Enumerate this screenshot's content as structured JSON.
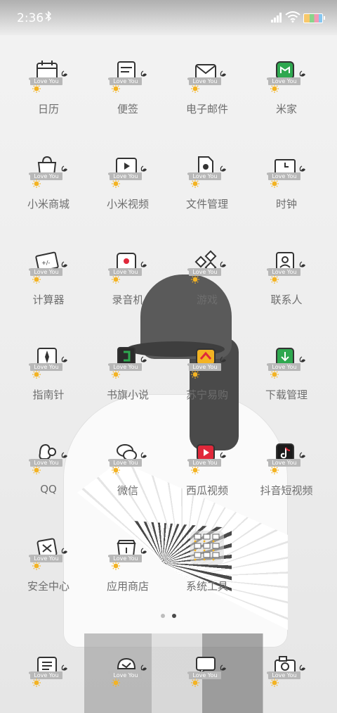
{
  "status_bar": {
    "time": "2:36"
  },
  "banner_text": "Love You",
  "apps": [
    {
      "id": "calendar",
      "label": "日历",
      "icon": "calendar-icon"
    },
    {
      "id": "notes",
      "label": "便签",
      "icon": "notes-icon"
    },
    {
      "id": "email",
      "label": "电子邮件",
      "icon": "email-icon"
    },
    {
      "id": "mijia",
      "label": "米家",
      "icon": "mijia-icon"
    },
    {
      "id": "mall",
      "label": "小米商城",
      "icon": "shopping-bag-icon"
    },
    {
      "id": "video",
      "label": "小米视频",
      "icon": "video-icon"
    },
    {
      "id": "files",
      "label": "文件管理",
      "icon": "file-icon"
    },
    {
      "id": "clock",
      "label": "时钟",
      "icon": "clock-icon"
    },
    {
      "id": "calculator",
      "label": "计算器",
      "icon": "calculator-icon"
    },
    {
      "id": "recorder",
      "label": "录音机",
      "icon": "recorder-icon"
    },
    {
      "id": "games",
      "label": "游戏",
      "icon": "game-icon"
    },
    {
      "id": "contacts",
      "label": "联系人",
      "icon": "contacts-icon"
    },
    {
      "id": "compass",
      "label": "指南针",
      "icon": "compass-icon"
    },
    {
      "id": "novel",
      "label": "书旗小说",
      "icon": "book-icon"
    },
    {
      "id": "suning",
      "label": "苏宁易购",
      "icon": "suning-icon"
    },
    {
      "id": "downloads",
      "label": "下载管理",
      "icon": "download-icon"
    },
    {
      "id": "qq",
      "label": "QQ",
      "icon": "qq-icon"
    },
    {
      "id": "wechat",
      "label": "微信",
      "icon": "wechat-icon"
    },
    {
      "id": "xigua",
      "label": "西瓜视频",
      "icon": "play-icon"
    },
    {
      "id": "douyin",
      "label": "抖音短视频",
      "icon": "douyin-icon"
    },
    {
      "id": "security",
      "label": "安全中心",
      "icon": "security-icon"
    },
    {
      "id": "appstore",
      "label": "应用商店",
      "icon": "store-icon"
    },
    {
      "id": "tools",
      "label": "系统工具",
      "icon": "folder-icon"
    }
  ],
  "dock": [
    {
      "id": "phone",
      "icon": "phone-icon"
    },
    {
      "id": "browser",
      "icon": "browser-icon"
    },
    {
      "id": "messages",
      "icon": "message-icon"
    },
    {
      "id": "camera",
      "icon": "camera-icon"
    }
  ],
  "colors": {
    "label": "#6e6e6e",
    "banner": "#bfbfbf",
    "sun": "#f3b323",
    "accent_green": "#2ea84f",
    "accent_red": "#e0283a"
  }
}
